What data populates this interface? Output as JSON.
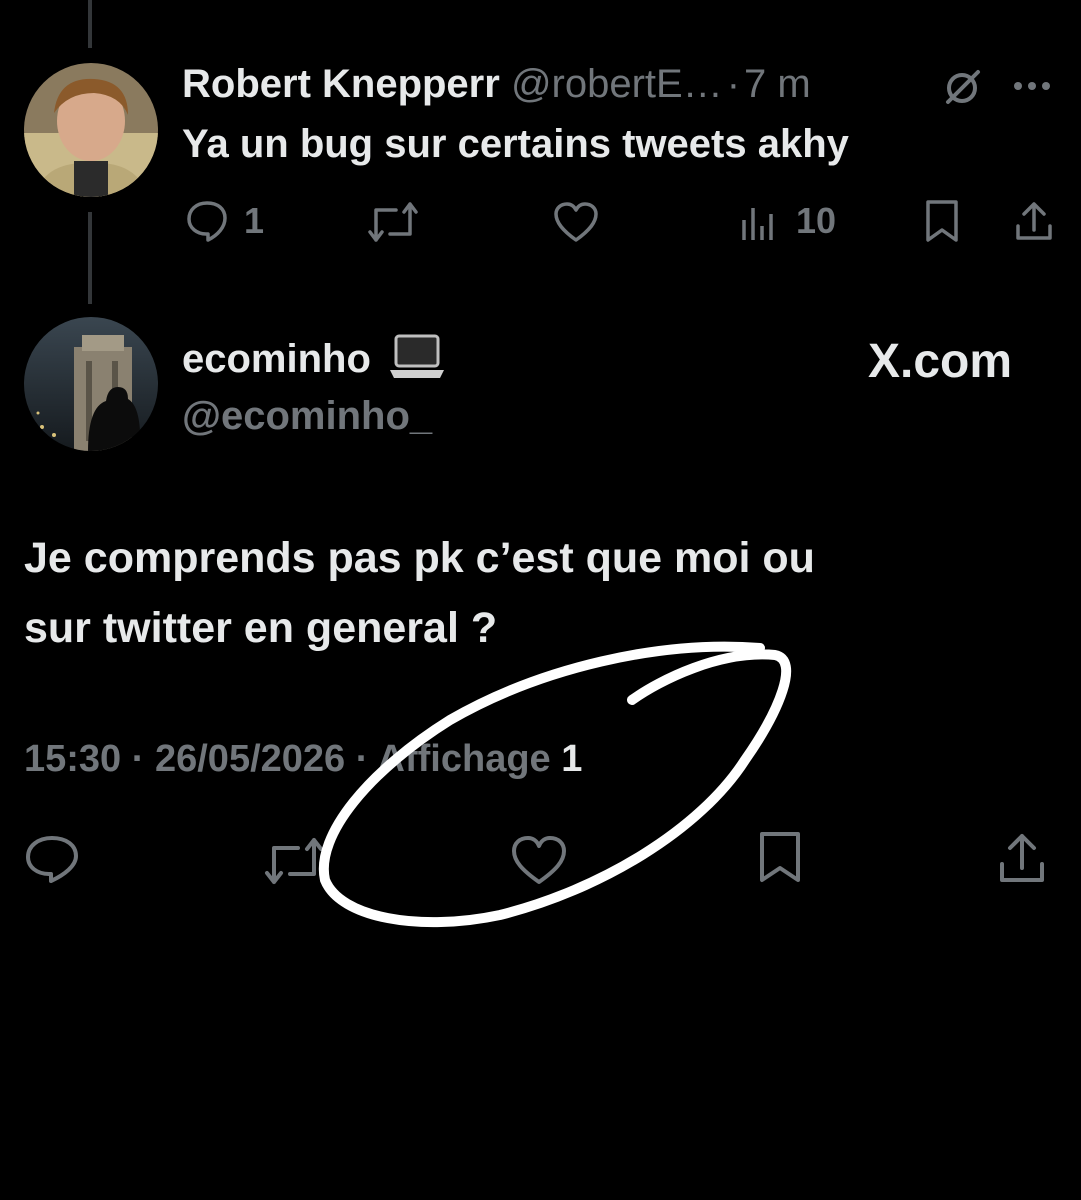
{
  "reply_tweet": {
    "author_name": "Robert Knepperr",
    "author_handle": "@robertE…",
    "separator": "·",
    "time": "7 m",
    "text": "Ya un bug sur certains tweets akhy",
    "actions": {
      "reply_count": "1",
      "views_count": "10"
    }
  },
  "main_tweet": {
    "author_name": "ecominho",
    "author_emoji": "💻",
    "author_handle": "@ecominho_",
    "brand": "X.com",
    "text_line1": "Je comprends pas pk c’est que moi ou",
    "text_line2": "sur twitter en general ?",
    "meta": {
      "time": "15:30",
      "sep1": "·",
      "date": "26/05/2026",
      "sep2": "·",
      "views_label": "Affichage",
      "views_count": "1"
    }
  },
  "icons": {
    "reply": "reply-icon",
    "retweet": "retweet-icon",
    "like": "like-icon",
    "views": "views-icon",
    "bookmark": "bookmark-icon",
    "share": "share-icon",
    "grok": "grok-icon",
    "more": "more-icon"
  },
  "colors": {
    "background": "#000000",
    "text_primary": "#e7e9ea",
    "text_secondary": "#71767b",
    "thread_line": "#333639",
    "annotation": "#ffffff"
  }
}
